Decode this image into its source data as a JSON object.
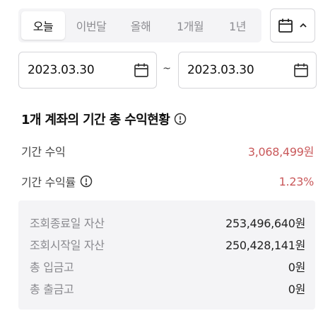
{
  "period_tabs": [
    {
      "label": "오늘",
      "active": true
    },
    {
      "label": "이번달",
      "active": false
    },
    {
      "label": "올해",
      "active": false
    },
    {
      "label": "1개월",
      "active": false
    },
    {
      "label": "1년",
      "active": false
    }
  ],
  "calendar_toggle": {
    "icon": "calendar-icon",
    "chevron": "chevron-up-icon"
  },
  "date_range": {
    "start": "2023.03.30",
    "separator": "~",
    "end": "2023.03.30"
  },
  "summary": {
    "title": "1개 계좌의 기간 총 수익현황",
    "profit_label": "기간 수익",
    "profit_value": "3,068,499원",
    "rate_label": "기간 수익률",
    "rate_value": "1.23%"
  },
  "details": [
    {
      "label": "조회종료일 자산",
      "value": "253,496,640원"
    },
    {
      "label": "조회시작일 자산",
      "value": "250,428,141원"
    },
    {
      "label": "총 입금고",
      "value": "0원"
    },
    {
      "label": "총 출금고",
      "value": "0원"
    }
  ],
  "colors": {
    "accent_red": "#c9595b",
    "panel_bg": "#f4f4f6"
  }
}
